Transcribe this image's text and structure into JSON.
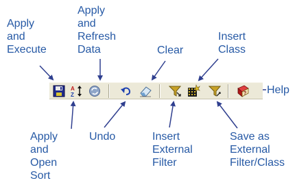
{
  "callouts": {
    "apply_execute": "Apply\nand\nExecute",
    "apply_refresh": "Apply\nand\nRefresh\nData",
    "clear": "Clear",
    "insert_class": "Insert\nClass",
    "help": "Help",
    "apply_open_sort": "Apply\nand\nOpen\nSort",
    "undo": "Undo",
    "insert_external_filter": "Insert\nExternal\nFilter",
    "save_external": "Save as\nExternal\nFilter/Class"
  },
  "toolbar": {
    "buttons": [
      {
        "id": "apply-execute",
        "icon": "floppy-disk-icon"
      },
      {
        "id": "apply-open-sort",
        "icon": "sort-az-icon"
      },
      {
        "id": "apply-refresh-data",
        "icon": "refresh-globe-icon"
      },
      {
        "id": "undo",
        "icon": "undo-arrow-icon"
      },
      {
        "id": "clear",
        "icon": "eraser-icon"
      },
      {
        "id": "insert-external-filter",
        "icon": "funnel-icon"
      },
      {
        "id": "insert-class",
        "icon": "class-grid-icon"
      },
      {
        "id": "save-external-filter-class",
        "icon": "funnel-save-icon"
      },
      {
        "id": "help",
        "icon": "help-book-icon"
      }
    ]
  },
  "colors": {
    "callout_text": "#2659a5",
    "arrow": "#2f3f8f",
    "toolbar_bg": "#ece9d8"
  }
}
